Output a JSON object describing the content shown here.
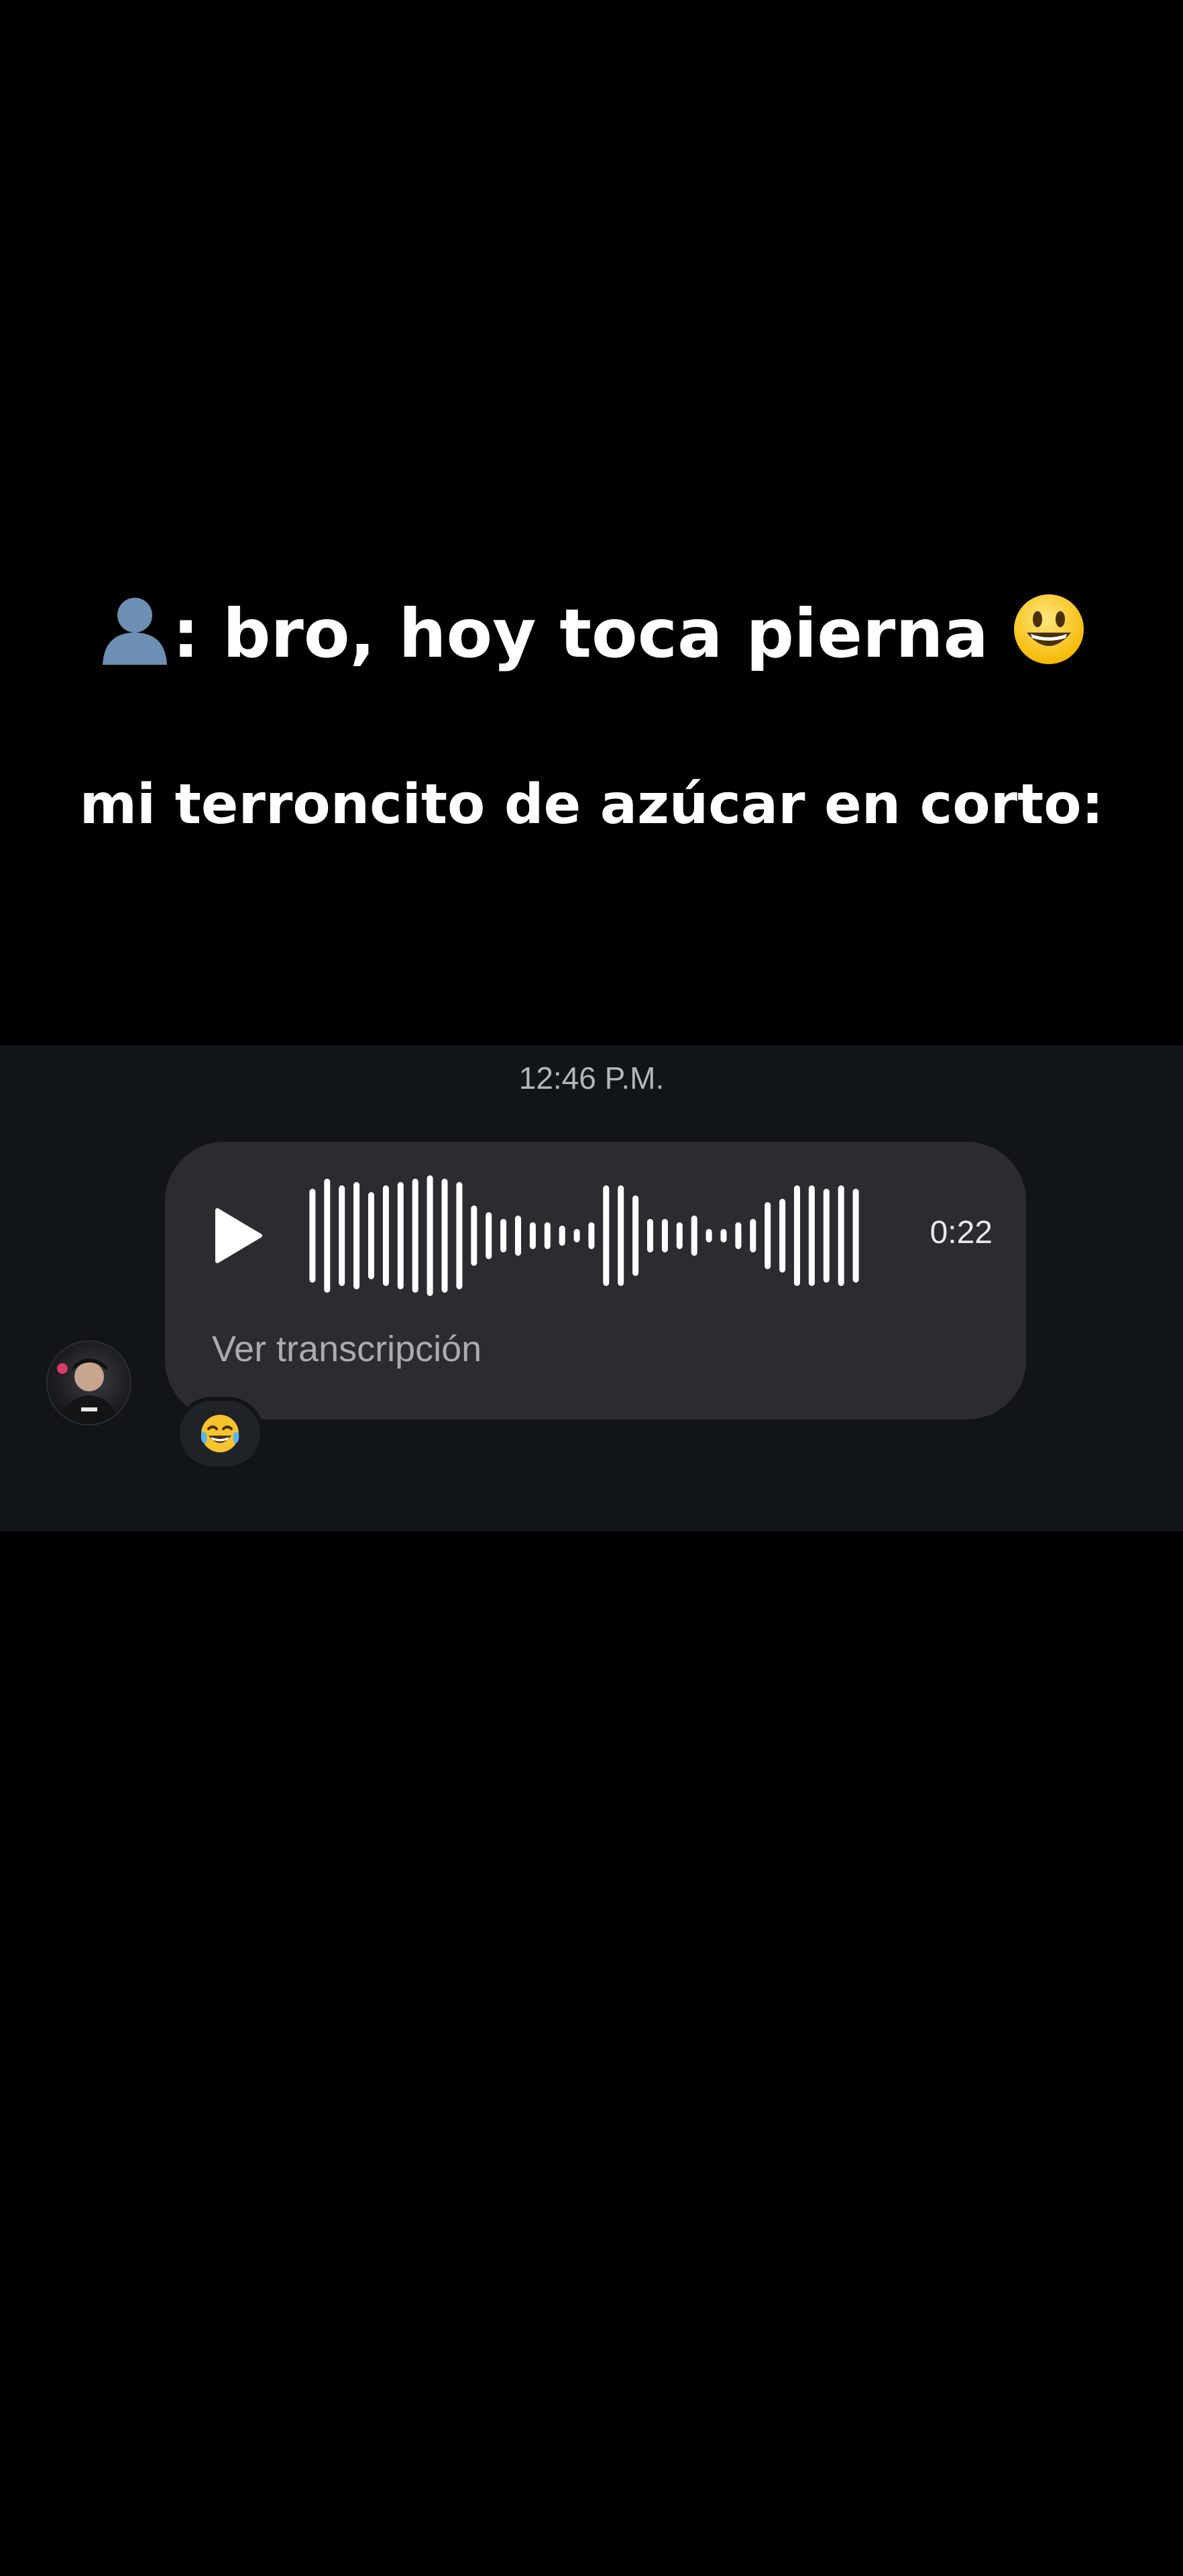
{
  "captions": {
    "line1_text": ": bro, hoy toca pierna ",
    "line1_leading_icon": "person-silhouette-icon",
    "line1_trailing_icon": "grinning-face-icon",
    "line2_text": "mi terroncito de azúcar en corto:"
  },
  "chat": {
    "timestamp": "12:46 P.M.",
    "voice_message": {
      "duration": "0:22",
      "transcript_link": "Ver transcripción",
      "play_icon": "play-icon"
    },
    "reaction": {
      "emoji_icon": "tears-of-joy-icon"
    },
    "sender_avatar": "avatar"
  },
  "colors": {
    "background": "#000000",
    "chat_panel": "#111418",
    "bubble": "#2a2c30",
    "waveform": "#ffffff",
    "timestamp": "#b3b6ba",
    "transcript_link": "#a9acb0"
  }
}
